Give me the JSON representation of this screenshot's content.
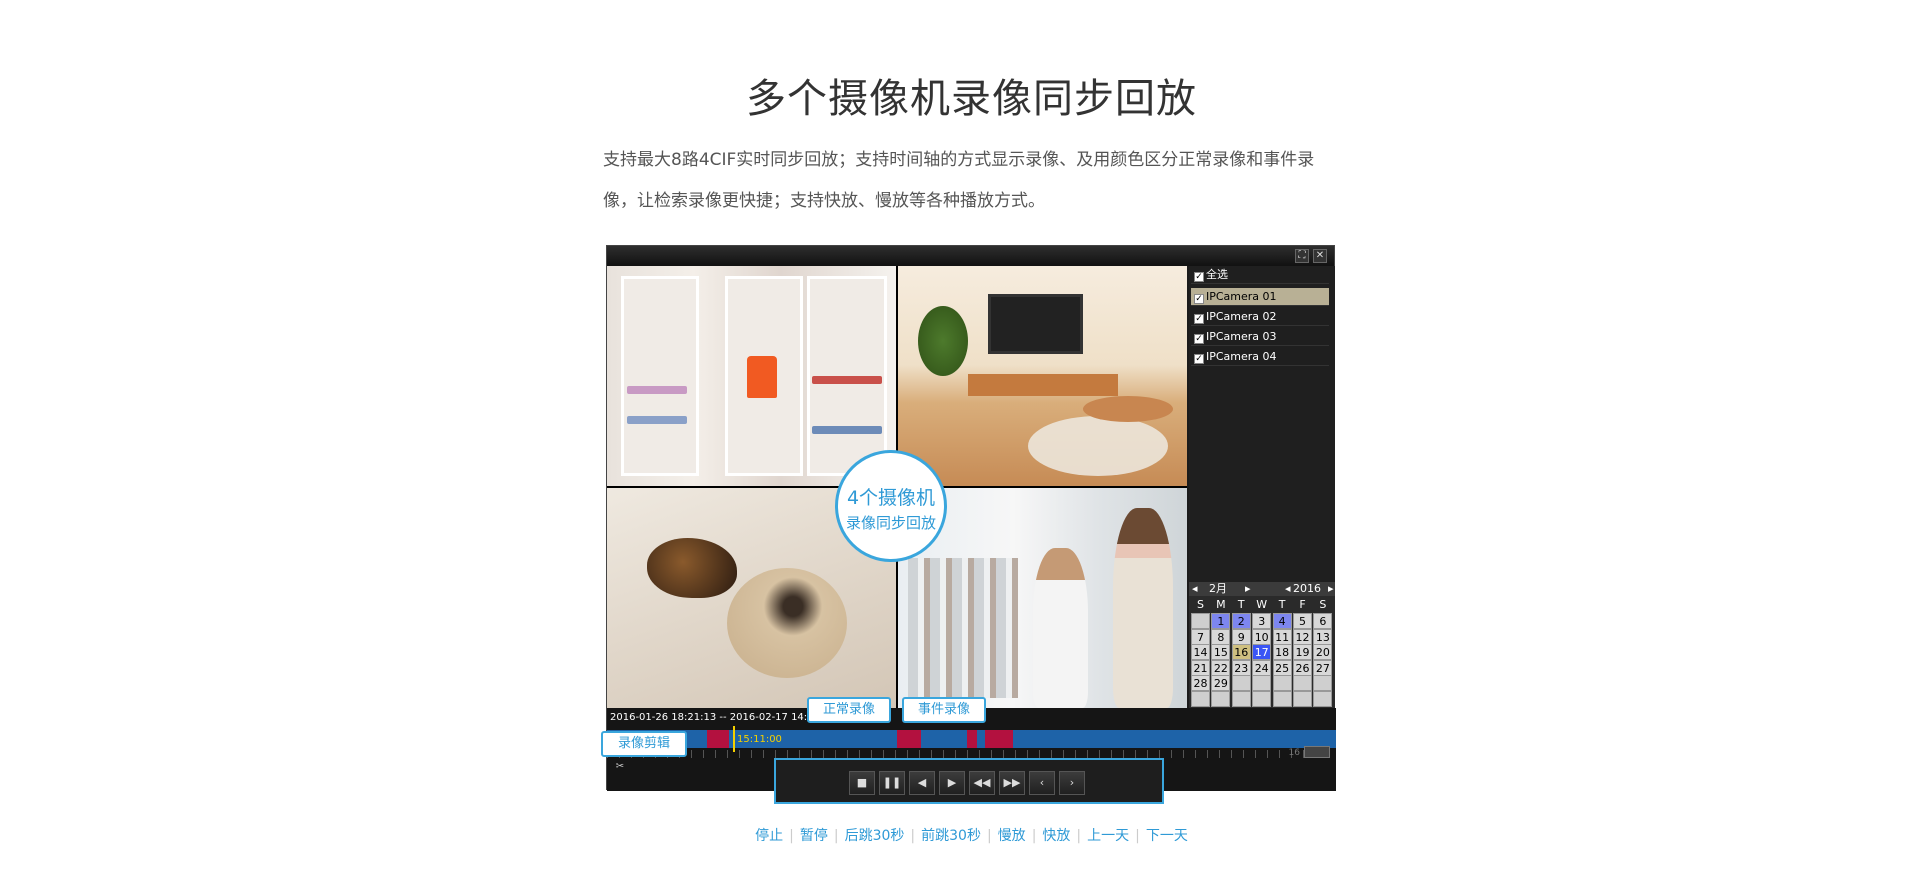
{
  "heading": "多个摄像机录像同步回放",
  "description": "支持最大8路4CIF实时同步回放；支持时间轴的方式显示录像、及用颜色区分正常录像和事件录像，让检索录像更快捷；支持快放、慢放等各种播放方式。",
  "overlay": {
    "line1": "4个摄像机",
    "line2": "录像同步回放"
  },
  "window_buttons": {
    "fullscreen": "⛶",
    "close": "✕"
  },
  "camera_list": {
    "select_all": "全选",
    "cameras": [
      "IPCamera 01",
      "IPCamera 02",
      "IPCamera 03",
      "IPCamera 04"
    ],
    "selected": "IPCamera 01"
  },
  "calendar": {
    "month": "2月",
    "year": "2016",
    "weekdays": [
      "S",
      "M",
      "T",
      "W",
      "T",
      "F",
      "S"
    ],
    "days": [
      "",
      "1",
      "2",
      "3",
      "4",
      "5",
      "6",
      "7",
      "8",
      "9",
      "10",
      "11",
      "12",
      "13",
      "14",
      "15",
      "16",
      "17",
      "18",
      "19",
      "20",
      "21",
      "22",
      "23",
      "24",
      "25",
      "26",
      "27",
      "28",
      "29",
      "",
      "",
      "",
      "",
      "",
      "",
      "",
      "",
      "",
      "",
      "",
      ""
    ],
    "recorded_days": [
      "1",
      "2",
      "4",
      "17"
    ],
    "current_day": "16"
  },
  "timeline": {
    "range": "2016-01-26 18:21:13 -- 2016-02-17 14:09:4",
    "cursor_time": "15:11:00",
    "scale_end": "16"
  },
  "callouts": {
    "normal": "正常录像",
    "event": "事件录像",
    "clip": "录像剪辑"
  },
  "controls": {
    "stop": "■",
    "pause": "❚❚",
    "back30": "◀",
    "fwd30": "▶",
    "slow": "◀◀",
    "fast": "▶▶",
    "prev_day": "‹",
    "next_day": "›"
  },
  "labels": [
    "停止",
    "暂停",
    "后跳30秒",
    "前跳30秒",
    "慢放",
    "快放",
    "上一天",
    "下一天"
  ],
  "colors": {
    "accent": "#2f9ad6",
    "normal_record": "#1e63a8",
    "event_record": "#b3113f"
  }
}
